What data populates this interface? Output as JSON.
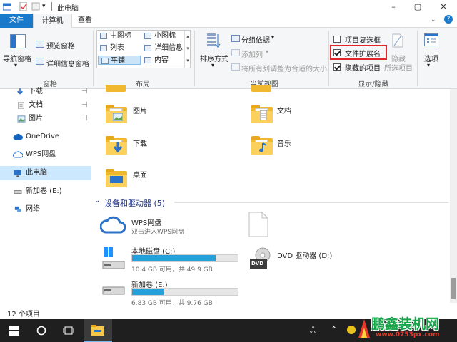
{
  "window": {
    "title": "此电脑",
    "controls": [
      "–",
      "▢",
      "✕"
    ],
    "help": "?"
  },
  "tabs": {
    "file": "文件",
    "computer": "计算机",
    "view": "查看"
  },
  "ribbon": {
    "panes": {
      "nav_pane": "导航窗格",
      "preview_pane": "预览窗格",
      "details_pane": "详细信息窗格",
      "group_label": "窗格"
    },
    "layout": {
      "items": [
        [
          "中图标",
          "小图标"
        ],
        [
          "列表",
          "详细信息"
        ],
        [
          "平铺",
          "内容"
        ]
      ],
      "selected": "平铺",
      "group_label": "布局"
    },
    "current_view": {
      "sort_by": "排序方式",
      "group_by": "分组依据",
      "add_column": "添加列",
      "size_all_columns": "将所有列调整为合适的大小",
      "group_label": "当前视图"
    },
    "show_hide": {
      "item_checkboxes": {
        "label": "项目复选框",
        "checked": false
      },
      "file_extensions": {
        "label": "文件扩展名",
        "checked": true
      },
      "hidden_items": {
        "label": "隐藏的项目",
        "checked": true
      },
      "hide": "隐藏",
      "selected_items": "所选项目",
      "group_label": "显示/隐藏"
    },
    "options": "选项"
  },
  "sidebar": {
    "items": [
      {
        "label": "下载",
        "pinned": true
      },
      {
        "label": "文档",
        "pinned": true
      },
      {
        "label": "图片",
        "pinned": true
      },
      {
        "label": "OneDrive"
      },
      {
        "label": "WPS网盘"
      },
      {
        "label": "此电脑",
        "selected": true
      },
      {
        "label": "新加卷 (E:)"
      },
      {
        "label": "网络"
      }
    ]
  },
  "folders": [
    {
      "label": "图片"
    },
    {
      "label": "文档"
    },
    {
      "label": "下载"
    },
    {
      "label": "音乐"
    },
    {
      "label": "桌面"
    }
  ],
  "devices": {
    "header": "设备和驱动器 (5)",
    "wps": {
      "name": "WPS网盘",
      "desc": "双击进入WPS网盘"
    },
    "drives": [
      {
        "name": "本地磁盘 (C:)",
        "free": "10.4 GB 可用，共 49.9 GB",
        "used_fraction": 0.79
      },
      {
        "name": "新加卷 (E:)",
        "free": "6.83 GB 可用，共 9.76 GB",
        "used_fraction": 0.3
      }
    ],
    "dvd": {
      "name": "DVD 驱动器 (D:)",
      "badge": "DVD"
    }
  },
  "status": {
    "count": "12 个项目"
  },
  "watermark": {
    "brand": "鹏鑫装机网",
    "url": "www.0753px.com"
  },
  "colors": {
    "accent": "#1979ca",
    "bar": "#26a0da",
    "highlight_box": "#e0262a",
    "folder": "#f5c84c",
    "taskbar": "#1f1f1f"
  }
}
